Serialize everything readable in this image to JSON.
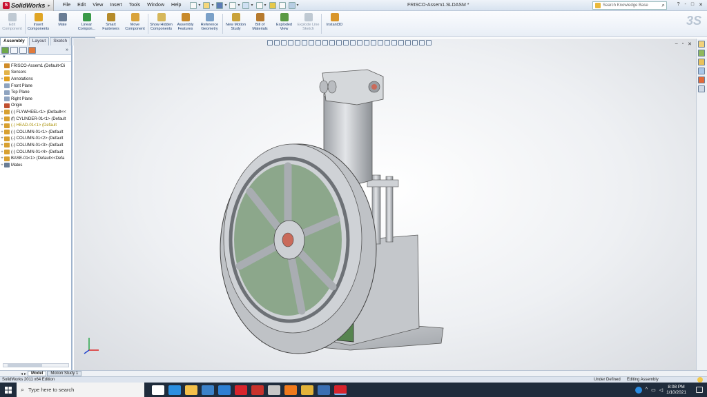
{
  "app": {
    "name": "SolidWorks",
    "document_title": "FRISCO-Assem1.SLDASM *",
    "menus": [
      "File",
      "Edit",
      "View",
      "Insert",
      "Tools",
      "Window",
      "Help"
    ],
    "knowledge_search_placeholder": "Search Knowledge Base",
    "window_controls": [
      "?",
      "-",
      "□",
      "✕"
    ]
  },
  "command_manager": {
    "buttons": [
      {
        "label": "Edit Component",
        "enabled": false,
        "icon": "edit-component-icon",
        "color": "#8899aa"
      },
      {
        "label": "Insert Components",
        "enabled": true,
        "icon": "insert-components-icon",
        "color": "#e0a524"
      },
      {
        "label": "Mate",
        "enabled": true,
        "icon": "mate-icon",
        "color": "#6a7d95"
      },
      {
        "label": "Linear Compon...",
        "enabled": true,
        "icon": "linear-pattern-icon",
        "color": "#3a9a48"
      },
      {
        "label": "Smart Fasteners",
        "enabled": true,
        "icon": "smart-fasteners-icon",
        "color": "#b58b2a"
      },
      {
        "label": "Move Component",
        "enabled": true,
        "icon": "move-component-icon",
        "color": "#d9a33b"
      },
      {
        "label": "Show Hidden Components",
        "enabled": true,
        "icon": "show-hidden-icon",
        "color": "#d6b75a"
      },
      {
        "label": "Assembly Features",
        "enabled": true,
        "icon": "assembly-features-icon",
        "color": "#c88a2b"
      },
      {
        "label": "Reference Geometry",
        "enabled": true,
        "icon": "reference-geometry-icon",
        "color": "#7aa0c8"
      },
      {
        "label": "New Motion Study",
        "enabled": true,
        "icon": "motion-study-icon",
        "color": "#c9a23a"
      },
      {
        "label": "Bill of Materials",
        "enabled": true,
        "icon": "bill-of-materials-icon",
        "color": "#b67a2e"
      },
      {
        "label": "Exploded View",
        "enabled": true,
        "icon": "exploded-view-icon",
        "color": "#5a9a44"
      },
      {
        "label": "Explode Line Sketch",
        "enabled": false,
        "icon": "explode-line-icon",
        "color": "#8899aa"
      },
      {
        "label": "Instant3D",
        "enabled": true,
        "icon": "instant3d-icon",
        "color": "#d9962b"
      }
    ],
    "tabs": [
      "Assembly",
      "Layout",
      "Sketch",
      "Evaluate"
    ],
    "active_tab": "Assembly"
  },
  "feature_tree": {
    "expand_symbol": "»",
    "filter_symbol": "▼",
    "nodes": [
      {
        "label": "FRISCO-Assem1  (Default<Di",
        "pm": "",
        "icon_color": "#d08c2a",
        "warn": false
      },
      {
        "label": "Sensors",
        "pm": "",
        "icon_color": "#e3b44a",
        "warn": false
      },
      {
        "label": "Annotations",
        "pm": "+",
        "icon_color": "#e0a020",
        "warn": false
      },
      {
        "label": "Front Plane",
        "pm": "",
        "icon_color": "#8fa4c0",
        "warn": false
      },
      {
        "label": "Top Plane",
        "pm": "",
        "icon_color": "#8fa4c0",
        "warn": false
      },
      {
        "label": "Right Plane",
        "pm": "",
        "icon_color": "#8fa4c0",
        "warn": false
      },
      {
        "label": "Origin",
        "pm": "",
        "icon_color": "#c05030",
        "warn": false
      },
      {
        "label": "(-) FLYWHEEL<1> (Default<<",
        "pm": "+",
        "icon_color": "#d8a030",
        "warn": false
      },
      {
        "label": "(f) CYLINDER-01<1> (Default",
        "pm": "+",
        "icon_color": "#d8a030",
        "warn": false
      },
      {
        "label": "(-) HEAD-01<1> (Default",
        "pm": "+",
        "icon_color": "#d8a030",
        "warn": true
      },
      {
        "label": "(-) COLUMN-01<1> (Default",
        "pm": "+",
        "icon_color": "#d8a030",
        "warn": false
      },
      {
        "label": "(-) COLUMN-01<2> (Default",
        "pm": "+",
        "icon_color": "#d8a030",
        "warn": false
      },
      {
        "label": "(-) COLUMN-01<3> (Default",
        "pm": "+",
        "icon_color": "#d8a030",
        "warn": false
      },
      {
        "label": "(-) COLUMN-01<4> (Default",
        "pm": "+",
        "icon_color": "#d8a030",
        "warn": false
      },
      {
        "label": "BASE-01<1> (Default<<Defa",
        "pm": "+",
        "icon_color": "#d8a030",
        "warn": false
      },
      {
        "label": "Mates",
        "pm": "+",
        "icon_color": "#6a7d95",
        "warn": false
      }
    ]
  },
  "viewport": {
    "model_colors": {
      "metal": "#c9ccd0",
      "metal_dark": "#8f9398",
      "base_panel": "#55834f",
      "accent": "#c96a5a"
    },
    "controls": [
      "–",
      "▫",
      "✕"
    ]
  },
  "bottom_tabs": {
    "nav": [
      "◂",
      "▸"
    ],
    "tabs": [
      "Model",
      "Motion Study 1"
    ],
    "active": "Model"
  },
  "status_bar": {
    "left": "SolidWorks 2011 x64 Edition",
    "state": "Under Defined",
    "mode": "Editing Assembly"
  },
  "taskbar": {
    "search_placeholder": "Type here to search",
    "time": "8:08 PM",
    "date": "1/10/2021",
    "apps": [
      {
        "icon": "task-view-icon",
        "color": "#ffffff"
      },
      {
        "icon": "edge-icon",
        "color": "#2b8fe0"
      },
      {
        "icon": "file-explorer-icon",
        "color": "#f3c04a"
      },
      {
        "icon": "store-icon",
        "color": "#3c82c9"
      },
      {
        "icon": "mail-icon",
        "color": "#2d7fd3"
      },
      {
        "icon": "solidworks-icon",
        "color": "#d7242c"
      },
      {
        "icon": "app-red-icon",
        "color": "#c8322c"
      },
      {
        "icon": "photos-icon",
        "color": "#c7c7c7"
      },
      {
        "icon": "firefox-icon",
        "color": "#f07a1d"
      },
      {
        "icon": "chrome-icon",
        "color": "#e2b33a"
      },
      {
        "icon": "files-icon",
        "color": "#3b6fb3"
      },
      {
        "icon": "solidworks-running-icon",
        "color": "#d7242c"
      }
    ]
  }
}
